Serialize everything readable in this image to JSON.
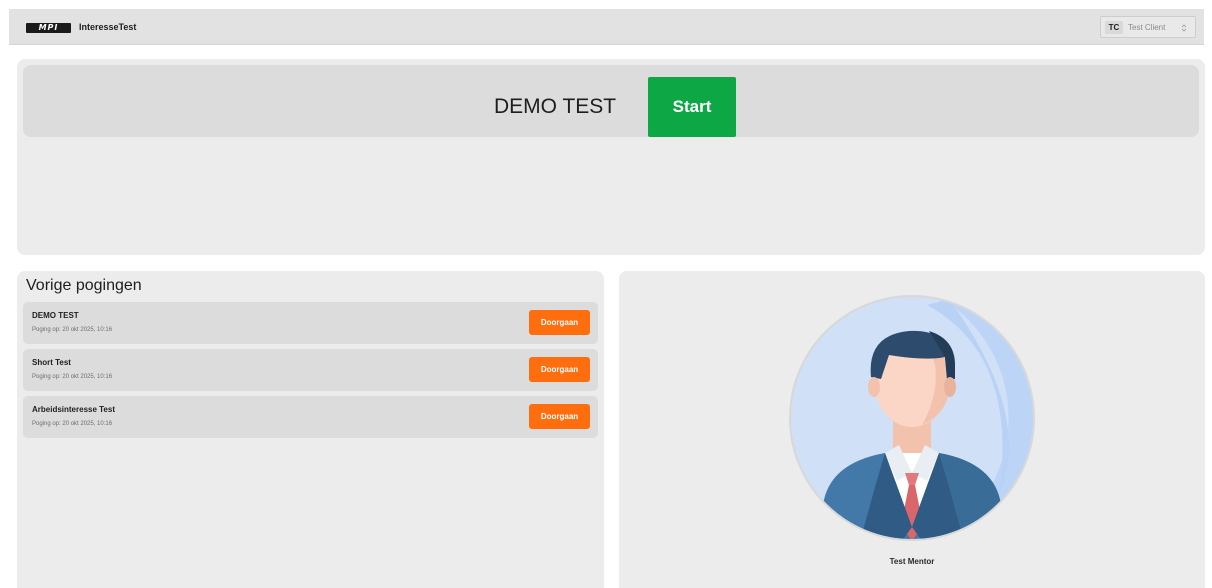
{
  "header": {
    "logo_text": "MPI",
    "app_name": "InteresseTest",
    "user": {
      "initials": "TC",
      "name": "Test Client"
    }
  },
  "test": {
    "title": "DEMO TEST",
    "start_label": "Start"
  },
  "attempts": {
    "title": "Vorige pogingen",
    "items": [
      {
        "name": "DEMO TEST",
        "date": "Poging op: 20 okt 2025, 10:16",
        "button_label": "Doorgaan"
      },
      {
        "name": "Short Test",
        "date": "Poging op: 20 okt 2025, 10:16",
        "button_label": "Doorgaan"
      },
      {
        "name": "Arbeidsinteresse Test",
        "date": "Poging op: 20 okt 2025, 10:16",
        "button_label": "Doorgaan"
      }
    ]
  },
  "mentor": {
    "name": "Test Mentor"
  },
  "colors": {
    "start_green": "#0da746",
    "continue_orange": "#fe6d0e",
    "panel_bg": "#ececec"
  }
}
